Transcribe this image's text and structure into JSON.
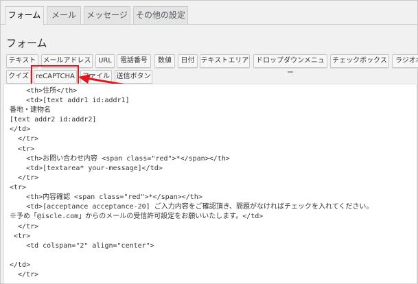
{
  "tabs": [
    {
      "label": "フォーム",
      "active": true
    },
    {
      "label": "メール"
    },
    {
      "label": "メッセージ"
    },
    {
      "label": "その他の設定"
    }
  ],
  "section_title": "フォーム",
  "tag_buttons_row1": [
    "テキスト",
    "メールアドレス",
    "URL",
    "電話番号",
    "数値",
    "日付",
    "テキストエリア",
    "ドロップダウンメニュー",
    "チェックボックス",
    "ラジオボ"
  ],
  "tag_buttons_row2": [
    "クイズ",
    "reCAPTCHA",
    "ファイル",
    "送信ボタン"
  ],
  "highlight_color": "#e2161c",
  "code_lines": [
    "    <th>住所</th>",
    "    <td>[text addr1 id:addr1]",
    "番地・建物名",
    "[text addr2 id:addr2]",
    "</td>",
    "  </tr>",
    "  <tr>",
    "    <th>お問い合わせ内容 <span class=\"red\">*</span></th>",
    "    <td>[textarea* your-message]</td>",
    "  </tr>",
    "<tr>",
    "    <th>内容確認 <span class=\"red\">*</span></th>",
    "    <td>[acceptance acceptance-20] ご入力内容をご確認頂き、問題がなければチェックを入れてください。",
    "※予め「@iscle.com」からのメールの受信許可設定をお願いいたします。</td>",
    "  </tr>",
    " <tr>",
    "    <td colspan=\"2\" align=\"center\">",
    "",
    "</td>",
    "  </tr>"
  ]
}
